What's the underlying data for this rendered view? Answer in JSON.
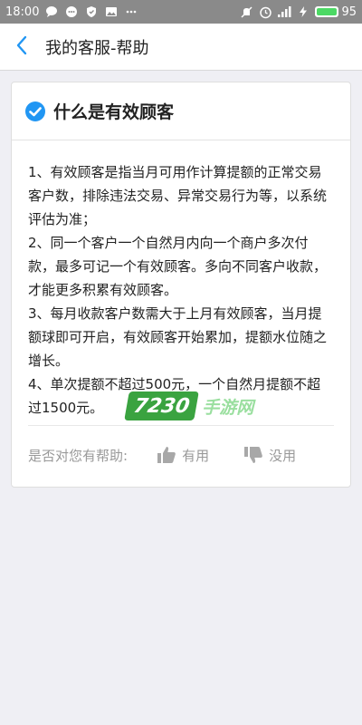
{
  "status_bar": {
    "time": "18:00",
    "battery_level": "95",
    "battery_color": "#4cd964"
  },
  "header": {
    "back_icon": "chevron-left-icon",
    "title": "我的客服-帮助"
  },
  "card": {
    "check_icon": "check-circle-icon",
    "title": "什么是有效顾客",
    "paragraphs": [
      "1、有效顾客是指当月可用作计算提额的正常交易客户数，排除违法交易、异常交易行为等，以系统评估为准；",
      "2、同一个客户一个自然月内向一个商户多次付款，最多可记一个有效顾客。多向不同客户收款，才能更多积累有效顾客。",
      "3、每月收款客户数需大于上月有效顾客，当月提额球即可开启，有效顾客开始累加，提额水位随之增长。",
      "4、单次提额不超过500元，一个自然月提额不超过1500元。"
    ],
    "feedback": {
      "label": "是否对您有帮助:",
      "useful": "有用",
      "useless": "没用"
    }
  },
  "watermark": {
    "number": "7230",
    "text": "手游网"
  },
  "colors": {
    "accent": "#2196f3",
    "watermark_green": "#3aa340"
  }
}
